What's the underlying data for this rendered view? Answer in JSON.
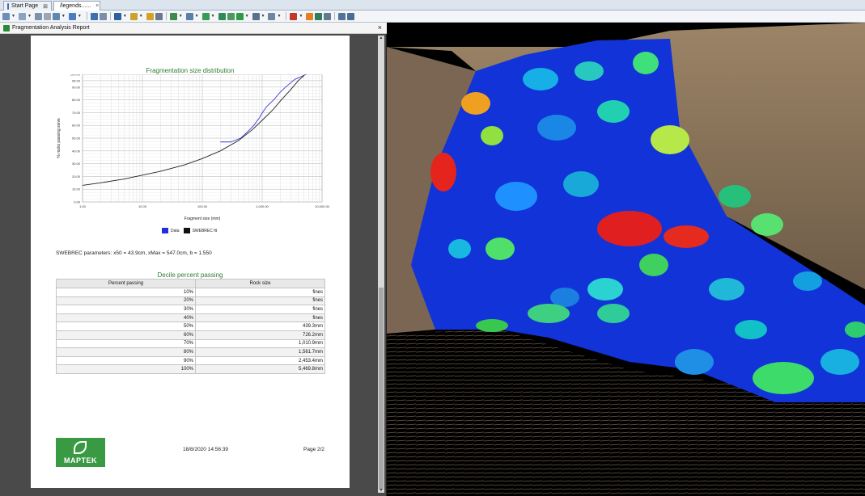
{
  "tabs": [
    {
      "label": "Start Page",
      "close": "⊠"
    },
    {
      "label": "/legends......",
      "close": "×"
    }
  ],
  "report": {
    "window_title": "Fragmentation Analysis Report",
    "close_glyph": "×"
  },
  "chart_data": {
    "type": "line",
    "title": "Fragmentation size distribution",
    "xlabel": "Fragment size (mm)",
    "ylabel": "% rocks passing sieve",
    "x_scale": "log",
    "xlim": [
      1,
      10000
    ],
    "ylim": [
      0,
      100
    ],
    "x_ticks": [
      "1.00",
      "10.00",
      "100.00",
      "1,000.00",
      "10,000.00"
    ],
    "y_ticks": [
      "0.00",
      "10.00",
      "20.00",
      "30.00",
      "40.00",
      "50.00",
      "60.00",
      "70.00",
      "80.00",
      "90.00",
      "95.00",
      "100.00"
    ],
    "grid": true,
    "legend_position": "bottom",
    "series": [
      {
        "name": "Data",
        "color": "#3b3bd6",
        "x": [
          200,
          300,
          439.3,
          600,
          726.2,
          900,
          1010.9,
          1200,
          1561.7,
          2000,
          2453.4,
          3500,
          5469.8
        ],
        "y": [
          47,
          47,
          50,
          56,
          60,
          66,
          70,
          75,
          80,
          86,
          90,
          96,
          100
        ]
      },
      {
        "name": "SWEBREC fit",
        "color": "#222222",
        "x": [
          1,
          2,
          5,
          10,
          20,
          50,
          100,
          200,
          400,
          700,
          1000,
          1500,
          2000,
          3000,
          4000,
          5000
        ],
        "y": [
          13,
          15,
          18,
          21,
          24,
          29,
          34,
          40,
          48,
          57,
          64,
          72,
          79,
          88,
          95,
          99
        ]
      }
    ]
  },
  "legend": {
    "data": "Data",
    "fit": "SWEBREC fit"
  },
  "params_text": "SWEBREC parameters: x50 = 43.9cm, xMax = 547.0cm, b = 1.550",
  "decile": {
    "title": "Decile percent passing",
    "headers": [
      "Percent passing",
      "Rock size"
    ],
    "rows": [
      [
        "10%",
        "fines"
      ],
      [
        "20%",
        "fines"
      ],
      [
        "30%",
        "fines"
      ],
      [
        "40%",
        "fines"
      ],
      [
        "50%",
        "439.3mm"
      ],
      [
        "60%",
        "726.2mm"
      ],
      [
        "70%",
        "1,010.9mm"
      ],
      [
        "80%",
        "1,561.7mm"
      ],
      [
        "90%",
        "2,453.4mm"
      ],
      [
        "100%",
        "5,469.8mm"
      ]
    ]
  },
  "footer": {
    "logo_text": "MAPTEK",
    "date": "18/8/2020 14:56:39",
    "page": "Page 2/2"
  }
}
